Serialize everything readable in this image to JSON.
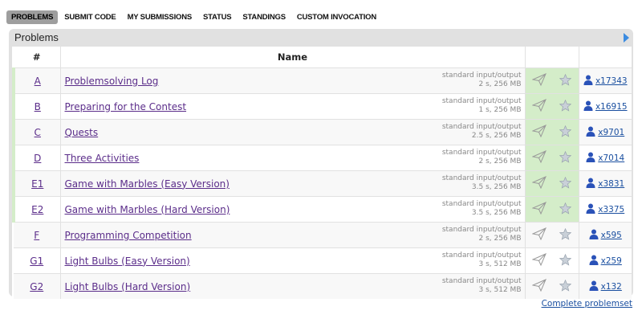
{
  "nav": {
    "tabs": [
      {
        "label": "PROBLEMS",
        "active": true
      },
      {
        "label": "SUBMIT CODE",
        "active": false
      },
      {
        "label": "MY SUBMISSIONS",
        "active": false
      },
      {
        "label": "STATUS",
        "active": false
      },
      {
        "label": "STANDINGS",
        "active": false
      },
      {
        "label": "CUSTOM INVOCATION",
        "active": false
      }
    ]
  },
  "panel": {
    "title": "Problems"
  },
  "table": {
    "headers": [
      "#",
      "Name"
    ],
    "rows": [
      {
        "index": "A",
        "name": "Problemsolving Log",
        "io": "standard input/output",
        "limits": "2 s, 256 MB",
        "solvers": "x17343",
        "solved": true
      },
      {
        "index": "B",
        "name": "Preparing for the Contest",
        "io": "standard input/output",
        "limits": "1 s, 256 MB",
        "solvers": "x16915",
        "solved": true
      },
      {
        "index": "C",
        "name": "Quests",
        "io": "standard input/output",
        "limits": "2.5 s, 256 MB",
        "solvers": "x9701",
        "solved": true
      },
      {
        "index": "D",
        "name": "Three Activities",
        "io": "standard input/output",
        "limits": "2 s, 256 MB",
        "solvers": "x7014",
        "solved": true
      },
      {
        "index": "E1",
        "name": "Game with Marbles (Easy Version)",
        "io": "standard input/output",
        "limits": "3.5 s, 256 MB",
        "solvers": "x3831",
        "solved": true
      },
      {
        "index": "E2",
        "name": "Game with Marbles (Hard Version)",
        "io": "standard input/output",
        "limits": "3.5 s, 256 MB",
        "solvers": "x3375",
        "solved": true
      },
      {
        "index": "F",
        "name": "Programming Competition",
        "io": "standard input/output",
        "limits": "2 s, 256 MB",
        "solvers": "x595",
        "solved": false
      },
      {
        "index": "G1",
        "name": "Light Bulbs (Easy Version)",
        "io": "standard input/output",
        "limits": "3 s, 512 MB",
        "solvers": "x259",
        "solved": false
      },
      {
        "index": "G2",
        "name": "Light Bulbs (Hard Version)",
        "io": "standard input/output",
        "limits": "3 s, 512 MB",
        "solvers": "x132",
        "solved": false
      }
    ]
  },
  "footer": {
    "complete_link": "Complete problemset"
  },
  "colors": {
    "accepted": "#d4edc9",
    "link": "#5b2d8a",
    "user_link": "#1a4fa0"
  },
  "icons": {
    "submit": "paper-plane-icon",
    "favorite": "star-icon",
    "user": "user-icon",
    "panel_arrow": "triangle-right-icon"
  }
}
